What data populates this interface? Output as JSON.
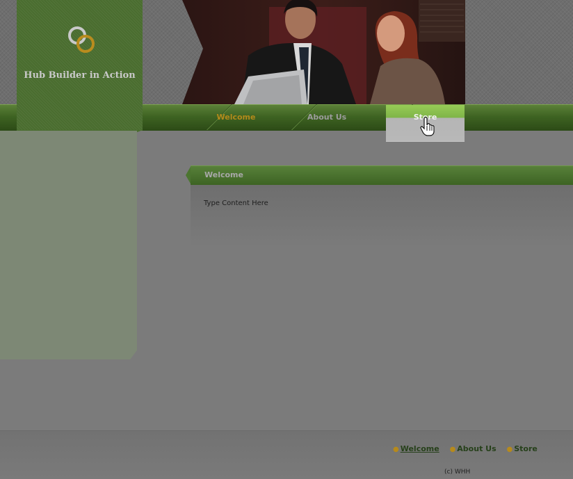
{
  "brand": {
    "title": "Hub Builder in Action",
    "logo_icon": "interlocking-rings-icon"
  },
  "nav": {
    "items": [
      {
        "label": "Welcome",
        "state": "current"
      },
      {
        "label": "About Us",
        "state": "normal"
      },
      {
        "label": "Store",
        "state": "hover"
      }
    ]
  },
  "content": {
    "title": "Welcome",
    "body": "Type Content Here"
  },
  "footer": {
    "links": [
      "Welcome",
      "About Us",
      "Store"
    ],
    "copyright": "(c) WHH"
  },
  "colors": {
    "nav_green": "#3e6322",
    "accent_gold": "#b3891a",
    "hover_green": "#8cc04f",
    "page_gray": "#7b7b7b"
  },
  "cursor_icon": "hand-pointer-icon"
}
